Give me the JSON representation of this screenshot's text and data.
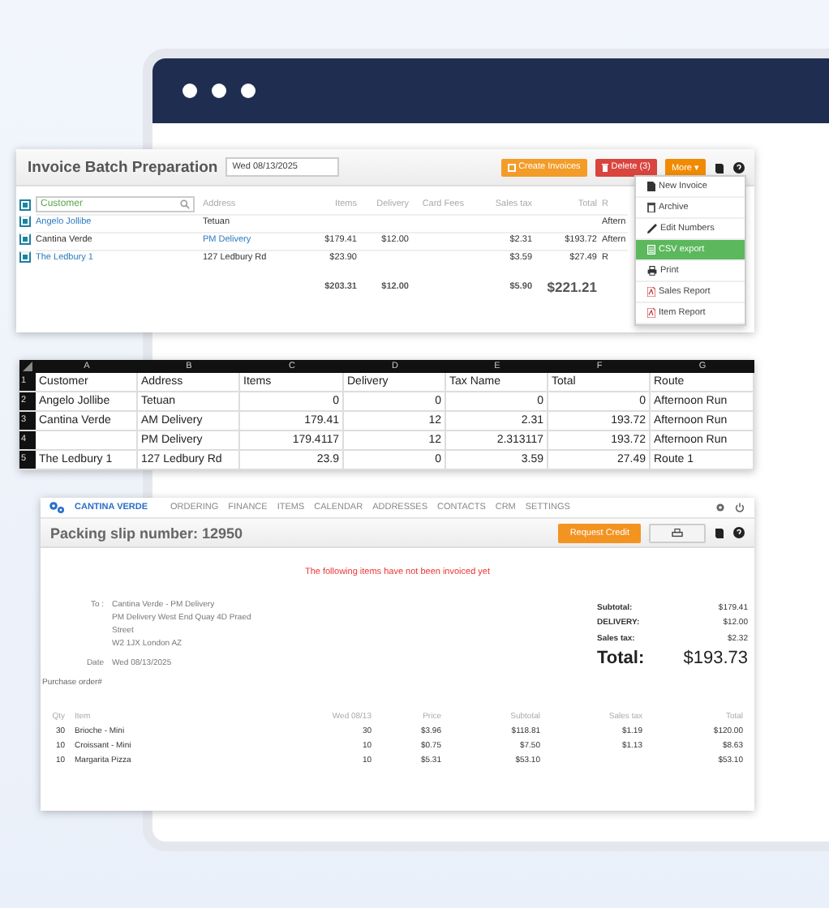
{
  "invoice_batch": {
    "title": "Invoice Batch Preparation",
    "date": "Wed 08/13/2025",
    "buttons": [
      {
        "label": "Create Invoices",
        "kind": "create"
      },
      {
        "label": "Delete (3)",
        "kind": "delete"
      },
      {
        "label": "More ▾",
        "kind": "more"
      }
    ],
    "select_all": {
      "checked": true
    },
    "search": {
      "placeholder": "Customer"
    },
    "columns": [
      "Address",
      "Items",
      "Delivery",
      "Card Fees",
      "Sales tax",
      "Total",
      "R"
    ],
    "rows": [
      {
        "checked": true,
        "customer": "Angelo Jollibe",
        "customer_link": true,
        "address_link": false,
        "cells": [
          "Tetuan",
          "",
          "",
          "",
          "",
          "",
          "Aftern"
        ]
      },
      {
        "checked": true,
        "customer": "Cantina Verde",
        "customer_link": false,
        "address_link": true,
        "cells": [
          "PM Delivery",
          "$179.41",
          "$12.00",
          "",
          "$2.31",
          "$193.72",
          "Aftern"
        ]
      },
      {
        "checked": true,
        "customer": "The Ledbury 1",
        "customer_link": true,
        "address_link": false,
        "cells": [
          "127 Ledbury Rd",
          "$23.90",
          "",
          "",
          "$3.59",
          "$27.49",
          "R"
        ]
      }
    ],
    "totals": {
      "items": "$203.31",
      "delivery": "$12.00",
      "sales_tax": "$5.90",
      "total": "$221.21"
    },
    "menu": [
      {
        "label": "New Invoice",
        "kind": "doc",
        "selected": false
      },
      {
        "label": "Archive",
        "kind": "trash",
        "selected": false
      },
      {
        "label": "Edit Numbers",
        "kind": "pencil",
        "selected": false
      },
      {
        "label": "CSV export",
        "kind": "csv",
        "selected": true
      },
      {
        "label": "Print",
        "kind": "print",
        "selected": false
      },
      {
        "label": "Sales Report",
        "kind": "pdf",
        "selected": false
      },
      {
        "label": "Item Report",
        "kind": "pdf",
        "selected": false
      }
    ]
  },
  "spreadsheet": {
    "column_letters": [
      "A",
      "B",
      "C",
      "D",
      "E",
      "F",
      "G"
    ],
    "row_numbers": [
      "1",
      "2",
      "3",
      "4",
      "5"
    ],
    "rows": [
      [
        "Customer",
        "Address",
        "Items",
        "Delivery",
        "Tax Name",
        "Total",
        "Route"
      ],
      [
        "Angelo Jollibe",
        "Tetuan",
        "0",
        "0",
        "0",
        "0",
        "Afternoon Run"
      ],
      [
        "Cantina Verde",
        "AM Delivery",
        "179.41",
        "12",
        "2.31",
        "193.72",
        "Afternoon Run"
      ],
      [
        "",
        "PM Delivery",
        "179.4117",
        "12",
        "2.313117",
        "193.72",
        "Afternoon Run"
      ],
      [
        "The Ledbury 1",
        "127 Ledbury Rd",
        "23.9",
        "0",
        "3.59",
        "27.49",
        "Route 1"
      ]
    ]
  },
  "packing_slip": {
    "brand": "CANTINA VERDE",
    "nav": [
      "ORDERING",
      "FINANCE",
      "ITEMS",
      "CALENDAR",
      "ADDRESSES",
      "CONTACTS",
      "CRM",
      "SETTINGS"
    ],
    "title": "Packing slip number: 12950",
    "request_button": "Request Credit",
    "notice": "The following items have not been invoiced yet",
    "to_label": "To :",
    "address": [
      "Cantina Verde - PM Delivery",
      "PM Delivery West End Quay 4D Praed",
      "Street",
      "W2 1JX London AZ"
    ],
    "date_label": "Date",
    "date": "Wed 08/13/2025",
    "totals": [
      {
        "label": "Subtotal:",
        "value": "$179.41",
        "kind": "line"
      },
      {
        "label": "DELIVERY:",
        "value": "$12.00",
        "kind": "line"
      },
      {
        "label": "Sales tax:",
        "value": "$2.32",
        "kind": "line"
      },
      {
        "label": "Total:",
        "value": "$193.73",
        "kind": "total"
      }
    ],
    "purchase_order": "Purchase order#",
    "columns": [
      "Qty",
      "Item",
      "Wed 08/13",
      "Price",
      "Subtotal",
      "Sales tax",
      "Total"
    ],
    "rows": [
      [
        "30",
        "Brioche - Mini",
        "30",
        "$3.96",
        "$118.81",
        "$1.19",
        "$120.00"
      ],
      [
        "10",
        "Croissant - Mini",
        "10",
        "$0.75",
        "$7.50",
        "$1.13",
        "$8.63"
      ],
      [
        "10",
        "Margarita Pizza",
        "10",
        "$5.31",
        "$53.10",
        "",
        "$53.10"
      ]
    ]
  }
}
